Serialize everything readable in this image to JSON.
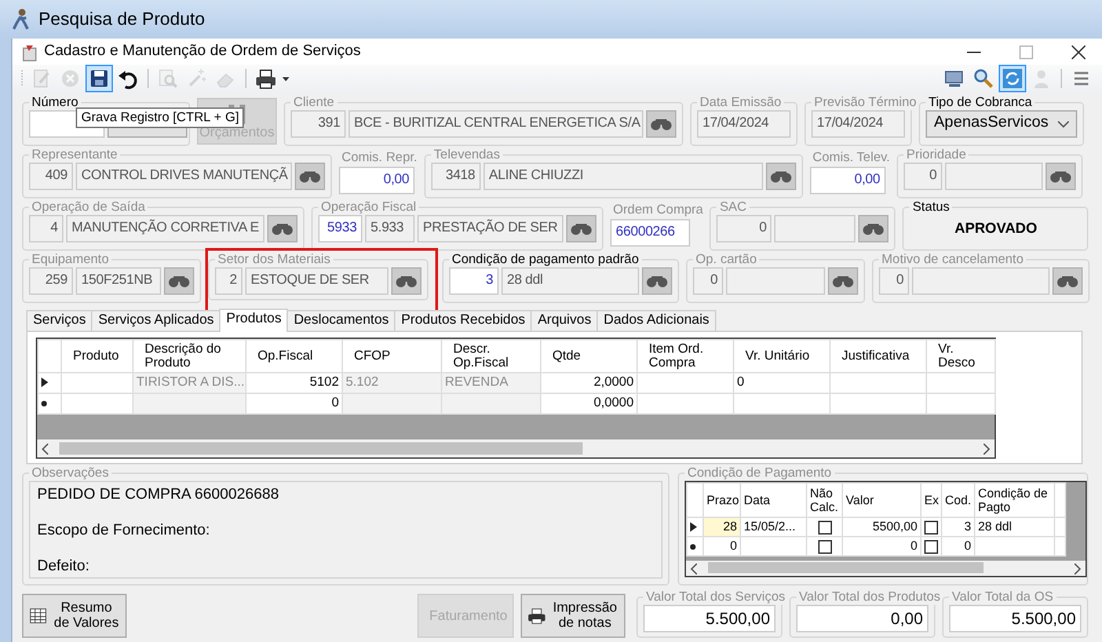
{
  "app_window": {
    "title": "Pesquisa de Produto"
  },
  "window": {
    "title": "Cadastro e Manutenção de Ordem de Serviços"
  },
  "toolbar_left": [
    [
      {
        "kind": "edit",
        "disabled": true,
        "selected": false
      },
      {
        "kind": "cancel",
        "disabled": true,
        "selected": false
      },
      {
        "kind": "save",
        "disabled": false,
        "selected": true
      },
      {
        "kind": "undo",
        "disabled": false,
        "selected": false
      }
    ],
    [
      {
        "kind": "find",
        "disabled": true,
        "selected": false
      },
      {
        "kind": "wand",
        "disabled": true,
        "selected": false
      },
      {
        "kind": "eraser",
        "disabled": true,
        "selected": false
      }
    ],
    [
      {
        "kind": "print",
        "disabled": false,
        "selected": false
      }
    ]
  ],
  "toolbar_right": [
    [
      {
        "kind": "monitor",
        "disabled": false,
        "selected": false
      },
      {
        "kind": "search",
        "disabled": false,
        "selected": false
      },
      {
        "kind": "refresh",
        "disabled": false,
        "selected": true
      },
      {
        "kind": "user",
        "disabled": true,
        "selected": false
      }
    ],
    [
      {
        "kind": "menu",
        "disabled": false,
        "selected": false
      }
    ]
  ],
  "tooltip": {
    "text": "Grava Registro [CTRL + G]"
  },
  "form_rows": [
    [
      {
        "kind": "number",
        "label": "Número",
        "disabled": false,
        "highlighted": false
      },
      {
        "kind": "big_button",
        "label": "Orçamentos",
        "disabled": true,
        "highlighted": false
      },
      {
        "kind": "lookup",
        "label": "Cliente",
        "disabled": true,
        "highlighted": false,
        "lookup_button": true,
        "fields": [
          {
            "kind": "code",
            "value": "391",
            "disabled": true
          },
          {
            "kind": "text",
            "value": "BCE - BURITIZAL CENTRAL ENERGETICA S/A",
            "disabled": true
          }
        ]
      },
      {
        "kind": "lookup",
        "label": "Data Emissão",
        "disabled": true,
        "highlighted": false,
        "lookup_button": false,
        "fields": [
          {
            "kind": "text",
            "value": "17/04/2024",
            "disabled": true
          }
        ]
      },
      {
        "kind": "lookup",
        "label": "Previsão Término",
        "disabled": true,
        "highlighted": false,
        "lookup_button": false,
        "fields": [
          {
            "kind": "text",
            "value": "17/04/2024",
            "disabled": true
          }
        ]
      },
      {
        "kind": "select",
        "label": "Tipo de Cobranca",
        "disabled": false,
        "highlighted": false,
        "value": "ApenasServicos"
      }
    ],
    [
      {
        "kind": "lookup",
        "label": "Representante",
        "disabled": true,
        "highlighted": false,
        "lookup_button": true,
        "fields": [
          {
            "kind": "code",
            "value": "409",
            "disabled": true
          },
          {
            "kind": "text",
            "value": "CONTROL DRIVES MANUTENÇÃ",
            "disabled": true
          }
        ]
      },
      {
        "kind": "plain",
        "label": "Comis. Repr.",
        "disabled": true,
        "highlighted": false,
        "fields": [
          {
            "kind": "code",
            "value": "0,00",
            "disabled": false
          }
        ]
      },
      {
        "kind": "lookup",
        "label": "Televendas",
        "disabled": true,
        "highlighted": false,
        "lookup_button": true,
        "fields": [
          {
            "kind": "code",
            "value": "3418",
            "disabled": true
          },
          {
            "kind": "text",
            "value": "ALINE CHIUZZI",
            "disabled": true
          }
        ]
      },
      {
        "kind": "plain",
        "label": "Comis. Telev.",
        "disabled": true,
        "highlighted": false,
        "fields": [
          {
            "kind": "code",
            "value": "0,00",
            "disabled": false
          }
        ]
      },
      {
        "kind": "lookup",
        "label": "Prioridade",
        "disabled": true,
        "highlighted": false,
        "lookup_button": true,
        "fields": [
          {
            "kind": "code",
            "value": "0",
            "disabled": true
          },
          {
            "kind": "text",
            "disabled": true
          }
        ]
      }
    ],
    [
      {
        "kind": "lookup",
        "label": "Operação de Saída",
        "disabled": true,
        "highlighted": false,
        "lookup_button": true,
        "fields": [
          {
            "kind": "code",
            "value": "4",
            "disabled": true
          },
          {
            "kind": "text",
            "value": "MANUTENÇÃO CORRETIVA E",
            "disabled": true
          }
        ]
      },
      {
        "kind": "lookup",
        "label": "Operação Fiscal",
        "disabled": true,
        "highlighted": false,
        "lookup_button": true,
        "fields": [
          {
            "kind": "code",
            "value": "5933",
            "disabled": false
          },
          {
            "kind": "text",
            "value": "5.933",
            "disabled": true
          },
          {
            "kind": "text",
            "value": "PRESTAÇÃO DE SER",
            "disabled": true
          }
        ]
      },
      {
        "kind": "plain",
        "label": "Ordem Compra",
        "disabled": true,
        "highlighted": false,
        "fields": [
          {
            "kind": "text",
            "value": "66000266",
            "disabled": false
          }
        ]
      },
      {
        "kind": "lookup",
        "label": "SAC",
        "disabled": true,
        "highlighted": false,
        "lookup_button": true,
        "fields": [
          {
            "kind": "code",
            "value": "0",
            "disabled": true
          },
          {
            "kind": "text",
            "disabled": true
          }
        ]
      },
      {
        "kind": "status",
        "label": "Status",
        "disabled": false,
        "highlighted": false,
        "value": "APROVADO"
      }
    ],
    [
      {
        "kind": "lookup",
        "label": "Equipamento",
        "disabled": true,
        "highlighted": false,
        "lookup_button": true,
        "fields": [
          {
            "kind": "code",
            "value": "259",
            "disabled": true
          },
          {
            "kind": "text",
            "value": "150F251NB",
            "disabled": true
          }
        ]
      },
      {
        "kind": "lookup",
        "label": "Setor dos Materiais",
        "disabled": true,
        "highlighted": true,
        "lookup_button": true,
        "fields": [
          {
            "kind": "code",
            "value": "2",
            "disabled": true
          },
          {
            "kind": "text",
            "value": "ESTOQUE DE SER",
            "disabled": true
          }
        ]
      },
      {
        "kind": "lookup",
        "label": "Condição de pagamento padrão",
        "disabled": false,
        "highlighted": false,
        "lookup_button": true,
        "fields": [
          {
            "kind": "code",
            "value": "3",
            "disabled": false
          },
          {
            "kind": "text",
            "value": "28 ddl",
            "disabled": true
          }
        ]
      },
      {
        "kind": "lookup",
        "label": "Op. cartão",
        "disabled": true,
        "highlighted": false,
        "lookup_button": true,
        "fields": [
          {
            "kind": "code",
            "value": "0",
            "disabled": true
          },
          {
            "kind": "text",
            "disabled": true
          }
        ]
      },
      {
        "kind": "lookup",
        "label": "Motivo de cancelamento",
        "disabled": true,
        "highlighted": false,
        "lookup_button": true,
        "fields": [
          {
            "kind": "code",
            "value": "0",
            "disabled": true
          },
          {
            "kind": "text",
            "disabled": true
          }
        ]
      }
    ]
  ],
  "tabs": [
    {
      "label": "Serviços",
      "selected": false
    },
    {
      "label": "Serviços Aplicados",
      "selected": false
    },
    {
      "label": "Produtos",
      "selected": true
    },
    {
      "label": "Deslocamentos",
      "selected": false
    },
    {
      "label": "Produtos Recebidos",
      "selected": false
    },
    {
      "label": "Arquivos",
      "selected": false
    },
    {
      "label": "Dados Adicionais",
      "selected": false
    }
  ],
  "products_grid": {
    "columns": [
      {
        "label": "Produto",
        "kind": "text",
        "readonly": false
      },
      {
        "label": "Descrição do Produto",
        "kind": "text",
        "readonly": true
      },
      {
        "label": "Op.Fiscal",
        "kind": "number",
        "readonly": false
      },
      {
        "label": "CFOP",
        "kind": "text",
        "readonly": true
      },
      {
        "label": "Descr. Op.Fiscal",
        "kind": "text",
        "readonly": true
      },
      {
        "label": "Qtde",
        "kind": "number",
        "readonly": false
      },
      {
        "label": "Item Ord. Compra",
        "kind": "text",
        "readonly": false
      },
      {
        "label": "Vr. Unitário",
        "kind": "text",
        "readonly": false
      },
      {
        "label": "Justificativa",
        "kind": "text",
        "readonly": false
      },
      {
        "label": "Vr. Desco",
        "kind": "text",
        "readonly": false
      }
    ],
    "rows": [
      {
        "kind": "current",
        "cells": [
          null,
          "TIRISTOR A DIS...",
          "5102",
          "5.102",
          "REVENDA",
          "2,0000",
          null,
          "0",
          null,
          null
        ]
      },
      {
        "kind": "new",
        "cells": [
          null,
          null,
          "0",
          null,
          null,
          "0,0000",
          null,
          null,
          null,
          null
        ]
      }
    ]
  },
  "observations": {
    "label": "Observações",
    "lines": [
      "PEDIDO DE COMPRA 6600026688",
      "Escopo de Fornecimento:",
      "Defeito:"
    ]
  },
  "payment": {
    "label": "Condição de Pagamento",
    "columns": [
      {
        "label": "Prazo",
        "kind": "number"
      },
      {
        "label": "Data",
        "kind": "text"
      },
      {
        "label": "Não Calc.",
        "kind": "check"
      },
      {
        "label": "Valor",
        "kind": "number"
      },
      {
        "label": "Ex",
        "kind": "check"
      },
      {
        "label": "Cod.",
        "kind": "number"
      },
      {
        "label": "Condição de Pagto",
        "kind": "text"
      }
    ],
    "rows": [
      {
        "kind": "current",
        "cells": [
          "28",
          "15/05/2...",
          false,
          "5500,00",
          false,
          "3",
          "28 ddl"
        ]
      },
      {
        "kind": "new",
        "cells": [
          "0",
          null,
          false,
          "0",
          false,
          "0",
          null
        ]
      }
    ]
  },
  "buttons": [
    {
      "kind": "summary",
      "label": "Resumo de Valores",
      "disabled": false
    },
    {
      "kind": "billing",
      "label": "Faturamento",
      "disabled": true
    },
    {
      "kind": "print",
      "label": "Impressão de notas",
      "disabled": false
    }
  ],
  "totals": [
    {
      "label": "Valor Total dos Serviços",
      "value": "5.500,00"
    },
    {
      "label": "Valor Total dos Produtos",
      "value": "0,00"
    },
    {
      "label": "Valor Total da OS",
      "value": "5.500,00"
    }
  ]
}
